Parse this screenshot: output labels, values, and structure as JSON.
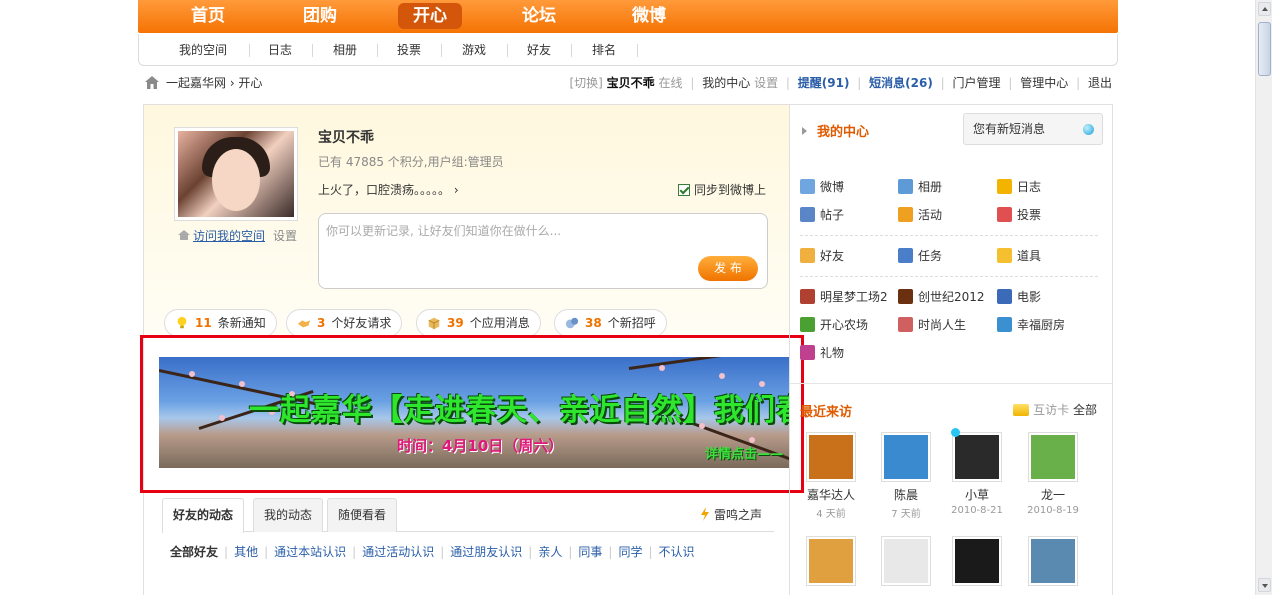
{
  "topnav": {
    "items": [
      {
        "label": "首页"
      },
      {
        "label": "团购"
      },
      {
        "label": "开心",
        "active": true
      },
      {
        "label": "论坛"
      },
      {
        "label": "微博"
      }
    ]
  },
  "subnav": {
    "items": [
      "我的空间",
      "日志",
      "相册",
      "投票",
      "游戏",
      "好友",
      "排名"
    ]
  },
  "breadcrumb": "一起嘉华网 › 开心",
  "userbar": {
    "switch": "[切换]",
    "username": "宝贝不乖",
    "online": "在线",
    "center": "我的中心",
    "settings": "设置",
    "reminders": "提醒(91)",
    "messages": "短消息(26)",
    "portal": "门户管理",
    "admin": "管理中心",
    "logout": "退出"
  },
  "profile": {
    "name": "宝贝不乖",
    "points": "已有 47885 个积分,用户组:管理员",
    "status": "上火了，口腔溃疡。。。。。 ›",
    "visit": "访问我的空间",
    "visit_settings": "设置",
    "sync": "同步到微博上",
    "post_placeholder": "你可以更新记录, 让好友们知道你在做什么...",
    "post_button": "发 布"
  },
  "notices": [
    {
      "count": "11",
      "label": "条新通知",
      "icon": "lightbulb-icon"
    },
    {
      "count": "3",
      "label": "个好友请求",
      "icon": "handshake-icon"
    },
    {
      "count": "39",
      "label": "个应用消息",
      "icon": "box-icon"
    },
    {
      "count": "38",
      "label": "个新招呼",
      "icon": "chat-icon"
    }
  ],
  "banner": {
    "title": "一起嘉华【走进春天、亲近自然】我们春游去",
    "date": "时间：4月10日（周六）",
    "more": "详情点击——"
  },
  "feed": {
    "tabs": [
      "好友的动态",
      "我的动态",
      "随便看看"
    ],
    "leiming": "雷鸣之声",
    "filters": [
      "全部好友",
      "其他",
      "通过本站认识",
      "通过活动认识",
      "通过朋友认识",
      "亲人",
      "同事",
      "同学",
      "不认识"
    ]
  },
  "sidebar": {
    "my_center": "我的中心",
    "new_msg": "您有新短消息",
    "apps_group1": [
      {
        "label": "微博",
        "color": "#6fa6e0"
      },
      {
        "label": "相册",
        "color": "#5d9ad6"
      },
      {
        "label": "日志",
        "color": "#f2b400"
      },
      {
        "label": "帖子",
        "color": "#5a86c8"
      },
      {
        "label": "活动",
        "color": "#f0a020"
      },
      {
        "label": "投票",
        "color": "#e05050"
      }
    ],
    "apps_group2": [
      {
        "label": "好友",
        "color": "#f0b040"
      },
      {
        "label": "任务",
        "color": "#4a7ec8"
      },
      {
        "label": "道具",
        "color": "#f5c030"
      }
    ],
    "apps_group3": [
      {
        "label": "明星梦工场2",
        "color": "#b04030"
      },
      {
        "label": "创世纪2012",
        "color": "#6a3010"
      },
      {
        "label": "电影",
        "color": "#3a6ab8"
      },
      {
        "label": "开心农场",
        "color": "#4aa030"
      },
      {
        "label": "时尚人生",
        "color": "#d06060"
      },
      {
        "label": "幸福厨房",
        "color": "#3a90d0"
      },
      {
        "label": "礼物",
        "color": "#c04090"
      }
    ],
    "recent_title": "最近来访",
    "card": "互访卡",
    "all": "全部",
    "visitors": [
      {
        "name": "嘉华达人",
        "time": "4 天前",
        "color": "#c8701a"
      },
      {
        "name": "陈晨",
        "time": "7 天前",
        "color": "#3a8ad0"
      },
      {
        "name": "小草",
        "time": "2010-8-21",
        "color": "#2a2a2a"
      },
      {
        "name": "龙一",
        "time": "2010-8-19",
        "color": "#6ab04a"
      },
      {
        "name": "",
        "time": "",
        "color": "#e0a040"
      },
      {
        "name": "",
        "time": "",
        "color": "#e8e8e8"
      },
      {
        "name": "",
        "time": "",
        "color": "#1a1a1a"
      },
      {
        "name": "",
        "time": "",
        "color": "#5a8ab0"
      }
    ]
  }
}
